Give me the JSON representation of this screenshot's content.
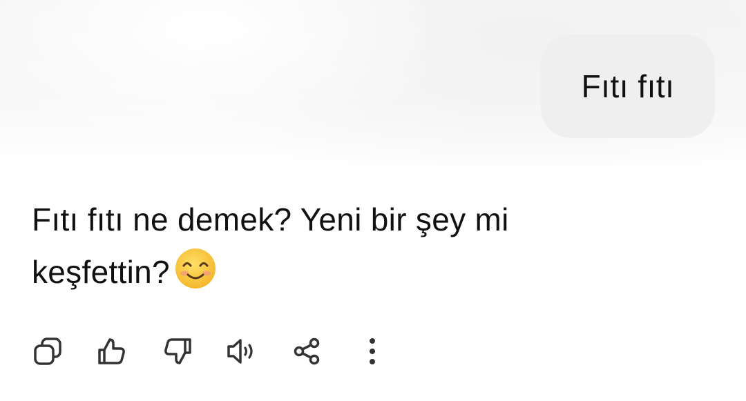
{
  "conversation": {
    "user_message": "Fıtı fıtı",
    "assistant_message": "Fıtı fıtı ne demek? Yeni bir şey mi keşfettin?",
    "assistant_emoji": "smiling-face-emoji"
  },
  "actions": [
    {
      "name": "copy",
      "icon": "copy-icon"
    },
    {
      "name": "like",
      "icon": "thumbs-up-icon"
    },
    {
      "name": "dislike",
      "icon": "thumbs-down-icon"
    },
    {
      "name": "read-aloud",
      "icon": "speaker-icon"
    },
    {
      "name": "share",
      "icon": "share-icon"
    },
    {
      "name": "more",
      "icon": "more-vertical-icon"
    }
  ],
  "colors": {
    "text": "#111111",
    "bubble": "#efefef",
    "icon": "#333333",
    "emoji_face": "#ffc83d"
  }
}
